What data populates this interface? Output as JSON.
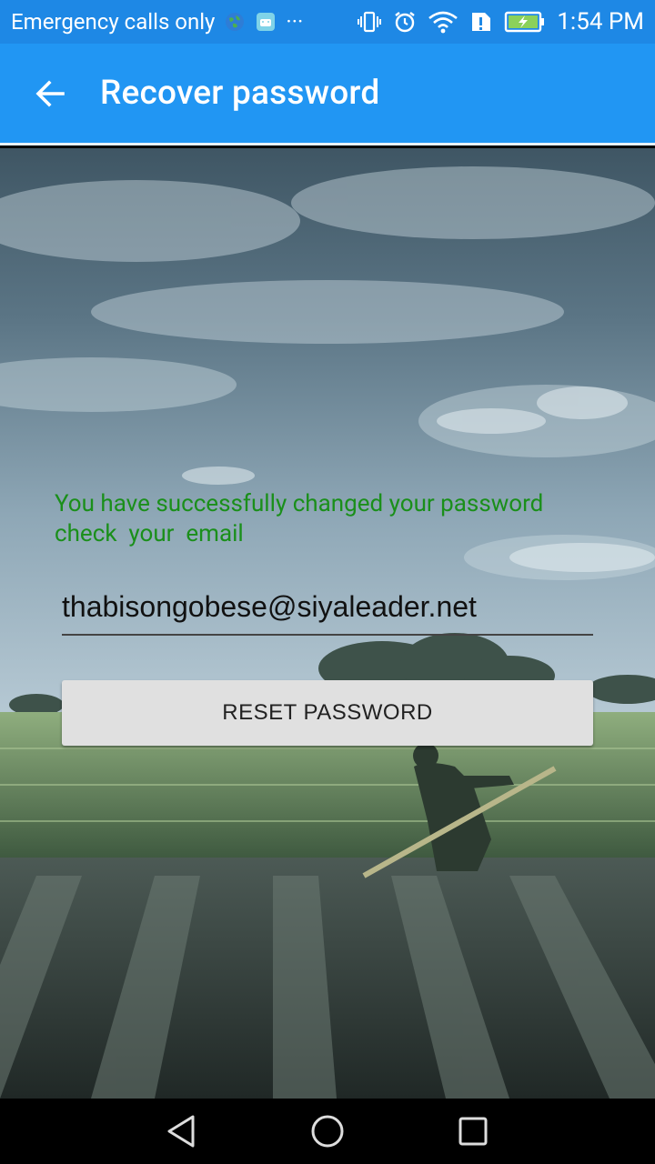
{
  "status_bar": {
    "carrier_text": "Emergency calls only",
    "overflow_text": "···",
    "time": "1:54 PM"
  },
  "app_bar": {
    "title": "Recover password"
  },
  "main": {
    "success_message": "You have successfully changed your password\ncheck  your  email",
    "email_value": "thabisongobese@siyaleader.net",
    "reset_button_label": "RESET PASSWORD"
  },
  "colors": {
    "app_bar": "#2196f3",
    "status_bar": "#1e88e5",
    "success_text": "#1a8f1a",
    "button_bg": "#e0e0e0"
  },
  "icons": {
    "back": "arrow-left-icon",
    "nav_back": "triangle-back-icon",
    "nav_home": "circle-home-icon",
    "nav_recents": "square-recents-icon"
  }
}
